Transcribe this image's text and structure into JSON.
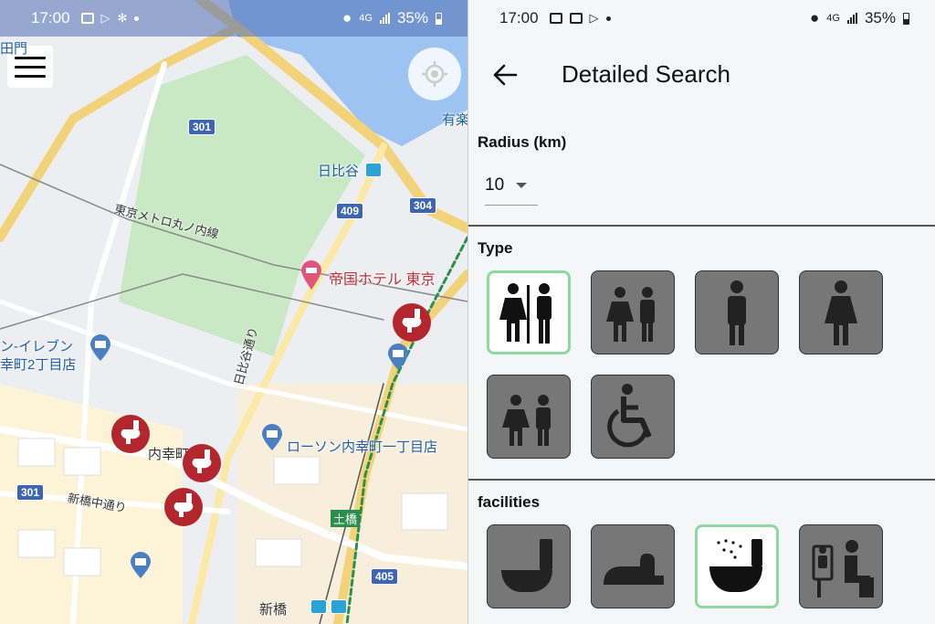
{
  "map_screen": {
    "status": {
      "time": "17:00",
      "battery": "35%",
      "network": "4G"
    },
    "labels": {
      "hibiya": "日比谷",
      "metro_line": "東京メトロ丸ノ内線",
      "imperial_hotel": "帝国ホテル 東京",
      "seven_eleven": "ン-イレブン",
      "seven_eleven_2": "幸町2丁目店",
      "lawson": "ローソン内幸町一丁目店",
      "uchisaiwaicho": "内幸町",
      "shinbashi_street": "新橋中通り",
      "shinbashi": "新橋",
      "hibiya_dori": "日比谷通り",
      "dobashi": "土橋",
      "yurakucho": "有楽",
      "top_left": "田門"
    },
    "route_shields": [
      "301",
      "304",
      "409",
      "301",
      "405"
    ]
  },
  "search_screen": {
    "status": {
      "time": "17:00",
      "battery": "35%",
      "network": "4G"
    },
    "title": "Detailed Search",
    "radius": {
      "label": "Radius (km)",
      "value": "10"
    },
    "type": {
      "label": "Type",
      "options": [
        {
          "icon": "all-gender-divided-icon",
          "selected": true
        },
        {
          "icon": "male-female-icon",
          "selected": false
        },
        {
          "icon": "male-icon",
          "selected": false
        },
        {
          "icon": "female-icon",
          "selected": false
        },
        {
          "icon": "multipurpose-icon",
          "selected": false
        },
        {
          "icon": "wheelchair-icon",
          "selected": false
        }
      ]
    },
    "facilities": {
      "label": "facilities",
      "options": [
        {
          "icon": "western-toilet-icon",
          "selected": false
        },
        {
          "icon": "japanese-toilet-icon",
          "selected": false
        },
        {
          "icon": "bidet-toilet-icon",
          "selected": true
        },
        {
          "icon": "baby-seat-icon",
          "selected": false
        }
      ]
    }
  },
  "colors": {
    "map_pin": "#b3262e",
    "selected_border": "#8fd8a0",
    "tile_off": "#777777",
    "park": "#c9e8c4",
    "road": "#f3d37a"
  }
}
